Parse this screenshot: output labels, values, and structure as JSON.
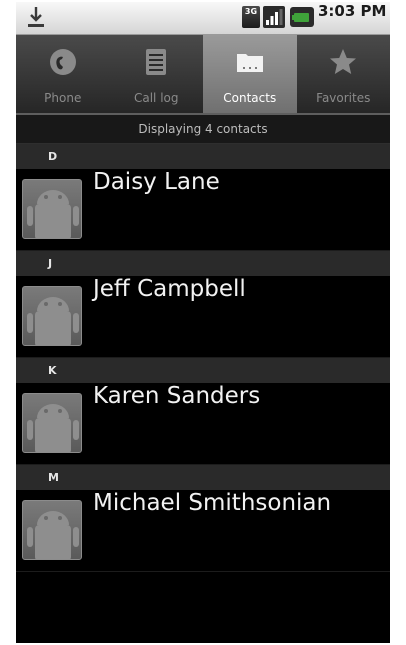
{
  "status_bar": {
    "time": "3:03 PM",
    "network_label": "3G",
    "icons": [
      "download-icon",
      "3g-icon",
      "signal-icon",
      "battery-icon"
    ]
  },
  "tabs": [
    {
      "label": "Phone",
      "icon": "phone-icon",
      "selected": false
    },
    {
      "label": "Call log",
      "icon": "call-log-icon",
      "selected": false
    },
    {
      "label": "Contacts",
      "icon": "contacts-folder-icon",
      "selected": true
    },
    {
      "label": "Favorites",
      "icon": "star-icon",
      "selected": false
    }
  ],
  "contacts_header": "Displaying 4 contacts",
  "sections": [
    {
      "letter": "D",
      "contacts": [
        {
          "name": "Daisy Lane"
        }
      ]
    },
    {
      "letter": "J",
      "contacts": [
        {
          "name": "Jeff Campbell"
        }
      ]
    },
    {
      "letter": "K",
      "contacts": [
        {
          "name": "Karen Sanders"
        }
      ]
    },
    {
      "letter": "M",
      "contacts": [
        {
          "name": "Michael Smithsonian"
        }
      ]
    }
  ],
  "colors": {
    "background": "#000000",
    "status_bar": "#e0e0e0",
    "tab_selected": "#8a8a8a",
    "section_header": "#2a2a2a",
    "battery_green": "#3fa33a"
  }
}
